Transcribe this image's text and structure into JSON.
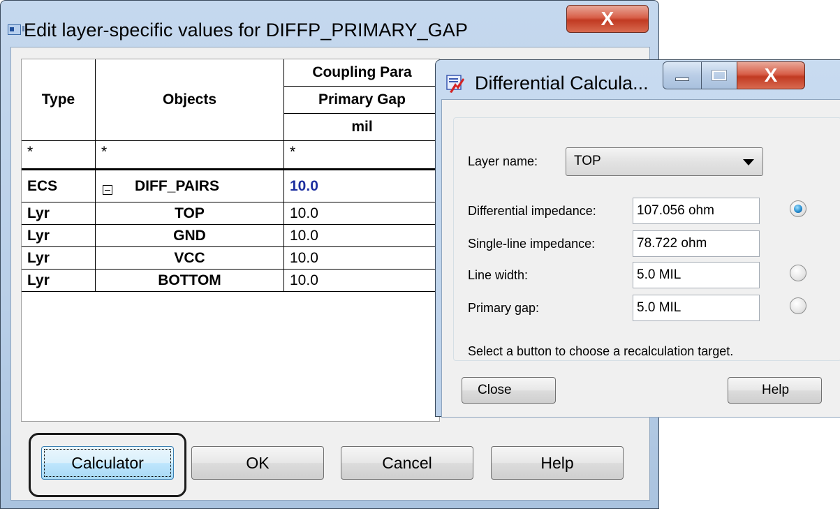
{
  "main_dialog": {
    "title": "Edit layer-specific values for DIFFP_PRIMARY_GAP",
    "close_glyph": "X",
    "table": {
      "headers": {
        "type": "Type",
        "objects": "Objects",
        "group": "Coupling Para",
        "column": "Primary Gap",
        "units": "mil"
      },
      "rows": [
        {
          "type": "*",
          "object": "*",
          "value": "*"
        },
        {
          "type": "ECS",
          "object": "DIFF_PAIRS",
          "value": "10.0"
        },
        {
          "type": "Lyr",
          "object": "TOP",
          "value": "10.0"
        },
        {
          "type": "Lyr",
          "object": "GND",
          "value": "10.0"
        },
        {
          "type": "Lyr",
          "object": "VCC",
          "value": "10.0"
        },
        {
          "type": "Lyr",
          "object": "BOTTOM",
          "value": "10.0"
        }
      ]
    },
    "buttons": {
      "calculator": "Calculator",
      "ok": "OK",
      "cancel": "Cancel",
      "help": "Help"
    }
  },
  "calc_dialog": {
    "title": "Differential Calcula...",
    "close_glyph": "X",
    "layer_name_label": "Layer name:",
    "layer_name_value": "TOP",
    "fields": {
      "diff_impedance_label": "Differential impedance:",
      "diff_impedance_value": "107.056 ohm",
      "single_impedance_label": "Single-line impedance:",
      "single_impedance_value": "78.722 ohm",
      "line_width_label": "Line width:",
      "line_width_value": "5.0 MIL",
      "primary_gap_label": "Primary gap:",
      "primary_gap_value": "5.0 MIL"
    },
    "selected_target": "diff_impedance",
    "hint": "Select a button to choose a recalculation target.",
    "buttons": {
      "close": "Close",
      "help": "Help"
    }
  }
}
